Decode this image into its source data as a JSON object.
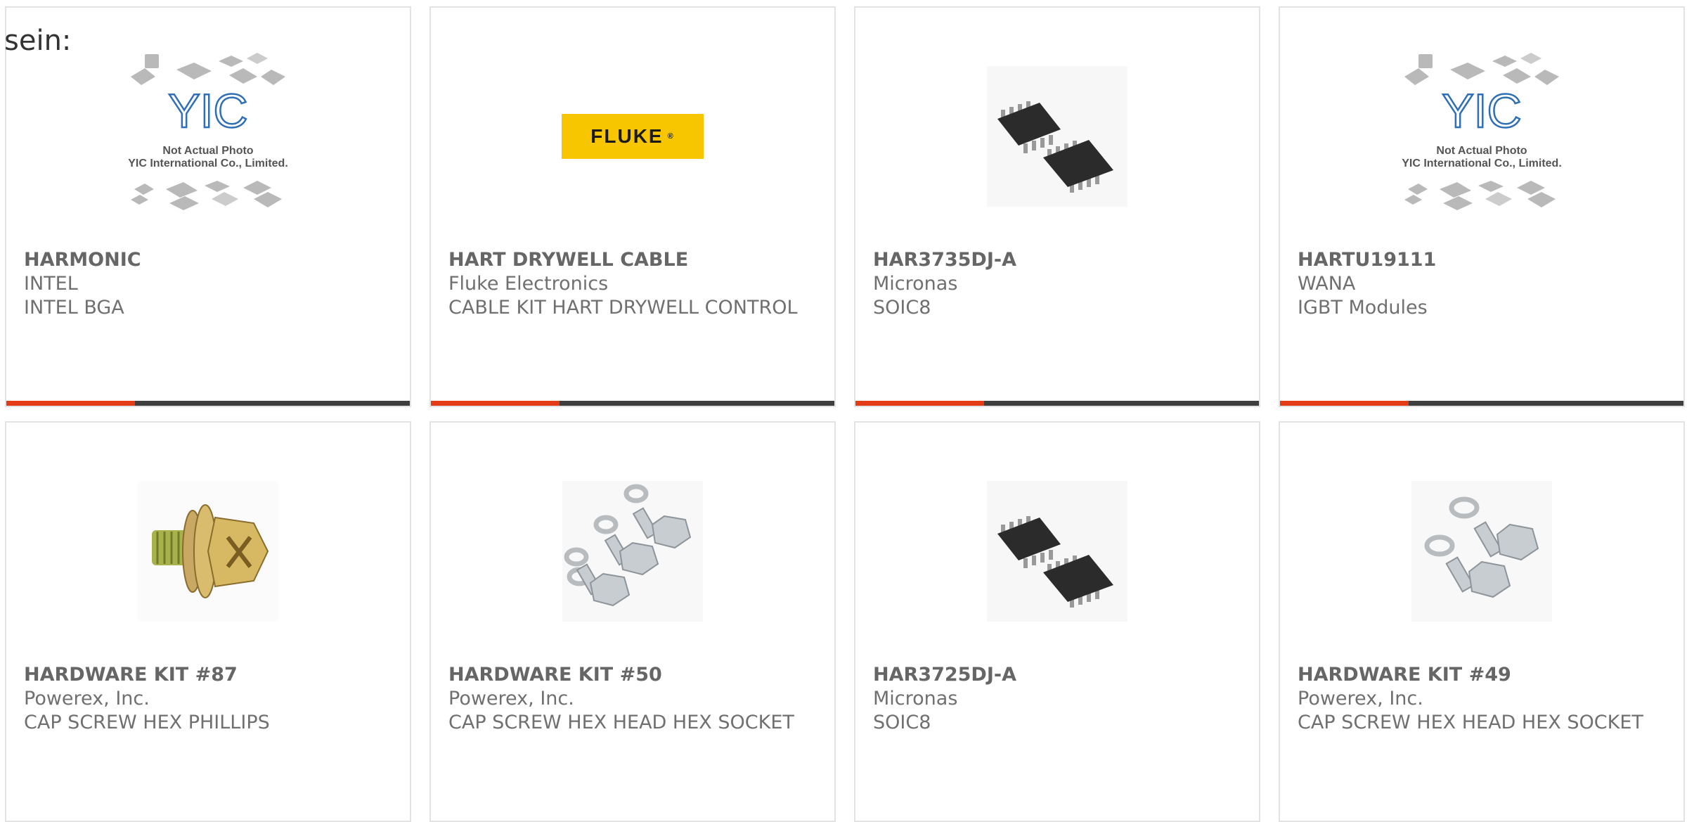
{
  "intro": "sein:",
  "colors": {
    "accent": "#e23b16",
    "bar": "#3e3e3e",
    "yellow": "#f7c600"
  },
  "products": [
    {
      "part": "HARMONIC",
      "maker": "INTEL",
      "desc": "INTEL BGA",
      "image": "yic-placeholder",
      "placeholder": {
        "line1": "Not Actual Photo",
        "line2": "YIC International Co., Limited.",
        "logo": "YIC"
      }
    },
    {
      "part": "HART DRYWELL CABLE",
      "maker": "Fluke Electronics",
      "desc": "CABLE KIT HART DRYWELL CONTROL",
      "image": "fluke-logo",
      "logo_text": "FLUKE"
    },
    {
      "part": "HAR3735DJ-A",
      "maker": "Micronas",
      "desc": "SOIC8",
      "image": "soic8-chip"
    },
    {
      "part": "HARTU19111",
      "maker": "WANA",
      "desc": "IGBT Modules",
      "image": "yic-placeholder",
      "placeholder": {
        "line1": "Not Actual Photo",
        "line2": "YIC International Co., Limited.",
        "logo": "YIC"
      }
    },
    {
      "part": "HARDWARE KIT #87",
      "maker": "Powerex, Inc.",
      "desc": "CAP SCREW HEX PHILLIPS",
      "image": "phillips-screw"
    },
    {
      "part": "HARDWARE KIT #50",
      "maker": "Powerex, Inc.",
      "desc": "CAP SCREW HEX HEAD HEX SOCKET",
      "image": "hex-bolt-kit"
    },
    {
      "part": "HAR3725DJ-A",
      "maker": "Micronas",
      "desc": "SOIC8",
      "image": "soic8-chip"
    },
    {
      "part": "HARDWARE KIT #49",
      "maker": "Powerex, Inc.",
      "desc": "CAP SCREW HEX HEAD HEX SOCKET",
      "image": "hex-bolt-kit"
    }
  ]
}
